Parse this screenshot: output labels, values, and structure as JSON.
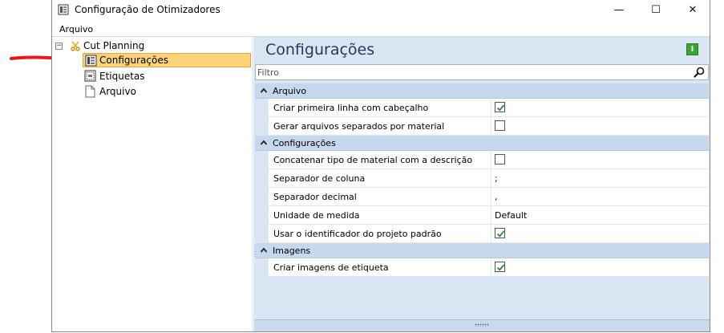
{
  "window": {
    "title": "Configuração de Otimizadores",
    "controls": {
      "minimize": "—",
      "maximize": "☐",
      "close": "✕"
    }
  },
  "menu": {
    "items": [
      "Arquivo"
    ]
  },
  "tree": {
    "root": {
      "label": "Cut Planning",
      "expander": "−",
      "icon": "scissors-icon"
    },
    "children": [
      {
        "label": "Configurações",
        "selected": true,
        "icon": "settings-document-icon"
      },
      {
        "label": "Etiquetas",
        "selected": false,
        "icon": "label-icon"
      },
      {
        "label": "Arquivo",
        "selected": false,
        "icon": "file-icon"
      }
    ]
  },
  "panel": {
    "title": "Configurações",
    "badge": "I",
    "filter": {
      "placeholder": "Filtro",
      "value": ""
    }
  },
  "groups": [
    {
      "label": "Arquivo",
      "rows": [
        {
          "name": "Criar primeira linha com cabeçalho",
          "type": "checkbox",
          "checked": true
        },
        {
          "name": "Gerar arquivos separados por material",
          "type": "checkbox",
          "checked": false
        }
      ]
    },
    {
      "label": "Configurações",
      "rows": [
        {
          "name": "Concatenar tipo de material com a descrição",
          "type": "checkbox",
          "checked": false
        },
        {
          "name": "Separador de coluna",
          "type": "text",
          "value": ";"
        },
        {
          "name": "Separador decimal",
          "type": "text",
          "value": ","
        },
        {
          "name": "Unidade de medida",
          "type": "text",
          "value": "Default"
        },
        {
          "name": "Usar o identificador do projeto padrão",
          "type": "checkbox",
          "checked": true
        }
      ]
    },
    {
      "label": "Imagens",
      "rows": [
        {
          "name": "Criar imagens de etiqueta",
          "type": "checkbox",
          "checked": true
        }
      ]
    }
  ],
  "colors": {
    "accent_arrow": "#e8191b",
    "selection": "#fcd27a",
    "check": "#2e8b2e",
    "panel_bg": "#dbe6f4"
  }
}
